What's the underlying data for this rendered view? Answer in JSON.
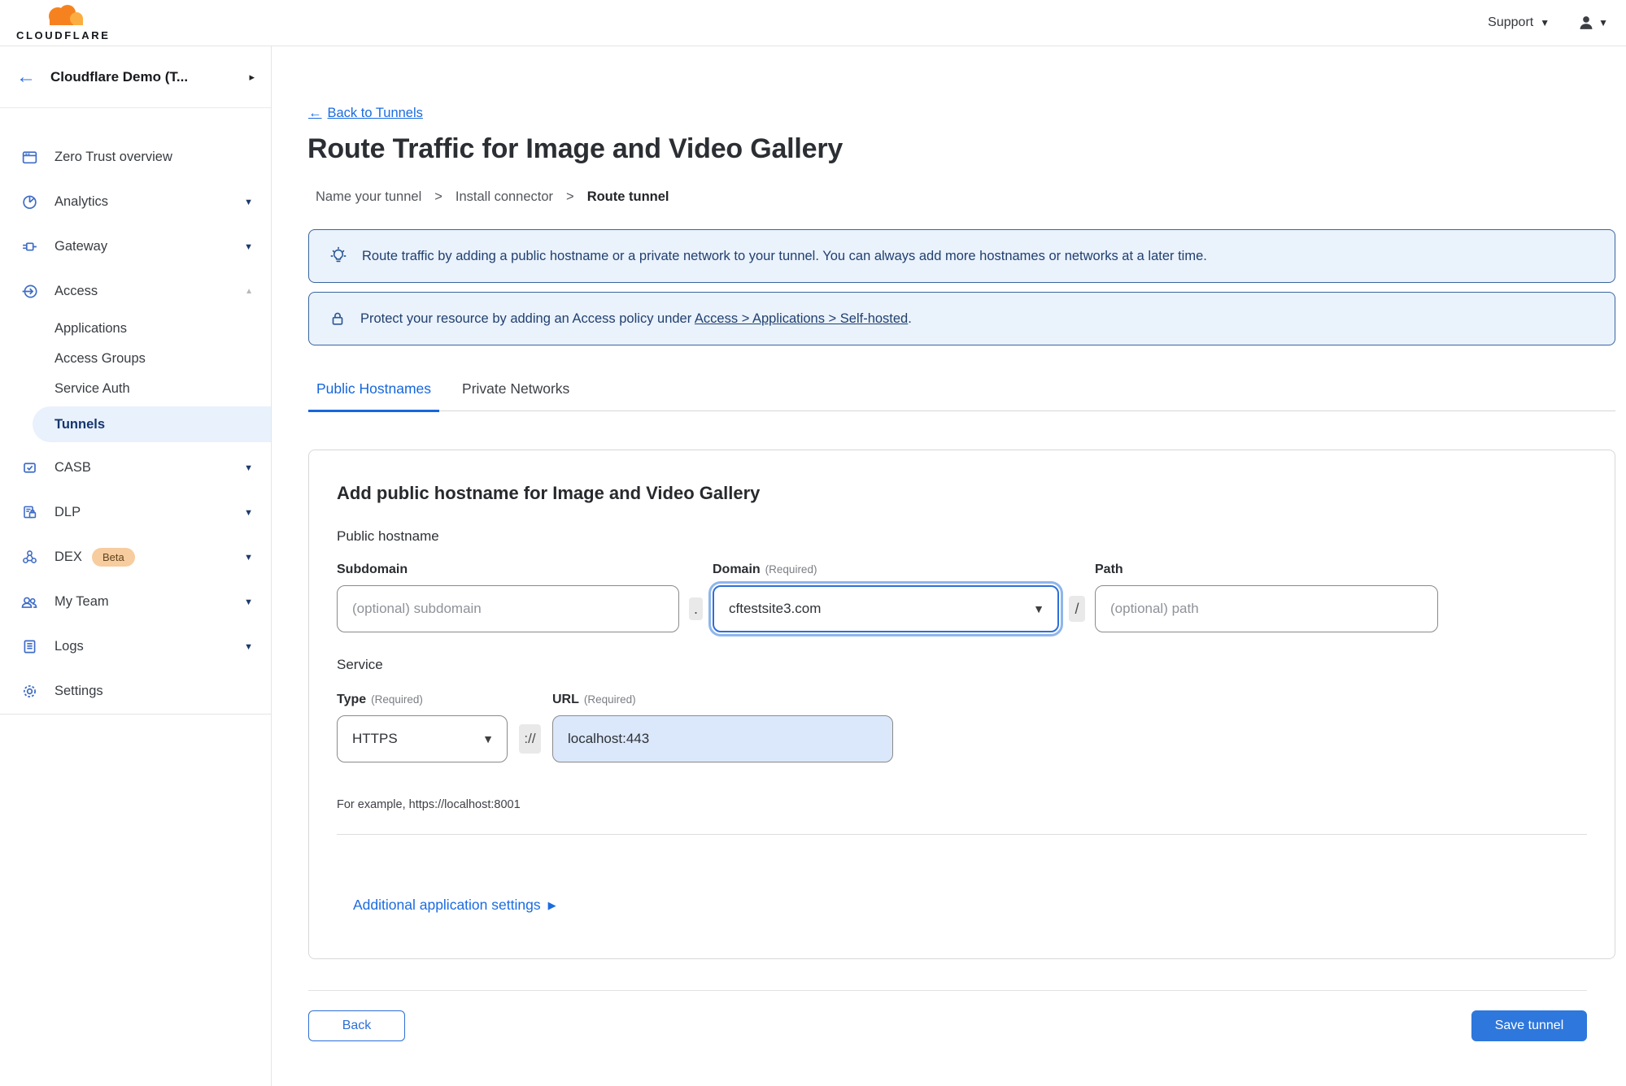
{
  "topbar": {
    "brand": "CLOUDFLARE",
    "support": "Support"
  },
  "sidebar": {
    "account": "Cloudflare Demo (T...",
    "items": {
      "overview": "Zero Trust overview",
      "analytics": "Analytics",
      "gateway": "Gateway",
      "access": "Access",
      "applications": "Applications",
      "access_groups": "Access Groups",
      "service_auth": "Service Auth",
      "tunnels": "Tunnels",
      "casb": "CASB",
      "dlp": "DLP",
      "dex": "DEX",
      "dex_badge": "Beta",
      "my_team": "My Team",
      "logs": "Logs",
      "settings": "Settings"
    }
  },
  "main": {
    "back_arrow": "←",
    "back_link": "Back to Tunnels",
    "title": "Route Traffic for Image and Video Gallery",
    "steps": {
      "step1": "Name your tunnel",
      "step2": "Install connector",
      "step3": "Route tunnel",
      "separator": ">"
    },
    "banners": {
      "tip": "Route traffic by adding a public hostname or a private network to your tunnel. You can always add more hostnames or networks at a later time.",
      "protect_prefix": "Protect your resource by adding an Access policy under",
      "protect_link": "Access > Applications > Self-hosted",
      "protect_suffix": "."
    },
    "tabs": {
      "public_hostnames": "Public Hostnames",
      "private_networks": "Private Networks"
    },
    "form": {
      "heading": "Add public hostname for Image and Video Gallery",
      "public_hostname_label": "Public hostname",
      "subdomain_label": "Subdomain",
      "subdomain_placeholder": "(optional) subdomain",
      "dot": ".",
      "domain_label": "Domain",
      "required": "(Required)",
      "domain_value": "cftestsite3.com",
      "slash": "/",
      "path_label": "Path",
      "path_placeholder": "(optional) path",
      "service_label": "Service",
      "type_label": "Type",
      "type_value": "HTTPS",
      "scheme_separator": "://",
      "url_label": "URL",
      "url_value": "localhost:443",
      "example": "For example, https://localhost:8001",
      "additional_settings": "Additional application settings"
    },
    "footer": {
      "back": "Back",
      "save": "Save tunnel"
    }
  },
  "colors": {
    "accent_blue": "#1b6ce0",
    "save_button": "#2e77dc",
    "banner_bg": "#eaf2fc",
    "banner_border": "#39659f",
    "banner_text": "#21406f",
    "selected_item_bg": "#e8f1fc",
    "selected_item_text": "#16356e",
    "sidebar_icon": "#3e6cc7",
    "beta_badge_bg": "#f7cc9f",
    "beta_badge_text": "#5f441f",
    "url_autofill_bg": "#dbe8fb",
    "logo_orange": "#f6821f",
    "logo_light_orange": "#fbad41"
  }
}
